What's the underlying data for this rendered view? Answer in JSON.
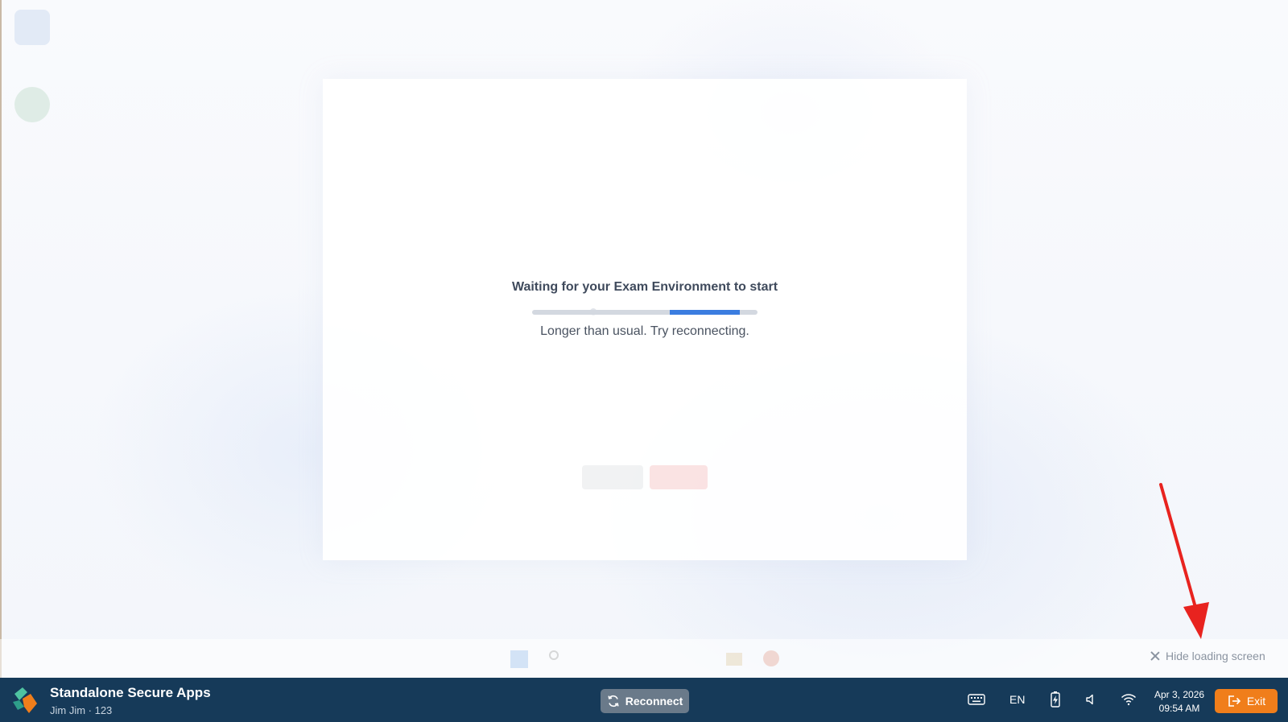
{
  "loading": {
    "title": "Waiting for your Exam Environment to start",
    "status": "Longer than usual. Try reconnecting.",
    "progress": 0.31
  },
  "hide_loading": {
    "label": "Hide loading screen"
  },
  "app_bar": {
    "app_name": "Standalone Secure Apps",
    "user": "Jim Jim · 123",
    "reconnect_label": "Reconnect",
    "language": "EN",
    "date": "Apr 3, 2026",
    "time": "09:54 AM",
    "exit_label": "Exit"
  },
  "colors": {
    "app_bar": "#163a59",
    "exit": "#f07e1b",
    "progress": "#3b7de0",
    "annotation_arrow": "#e8231f"
  },
  "icons": {
    "hide": "close-icon",
    "reconnect": "refresh-icon",
    "keyboard": "keyboard-icon",
    "battery": "battery-charging-icon",
    "volume": "volume-icon",
    "wifi": "wifi-icon",
    "exit": "exit-icon"
  }
}
